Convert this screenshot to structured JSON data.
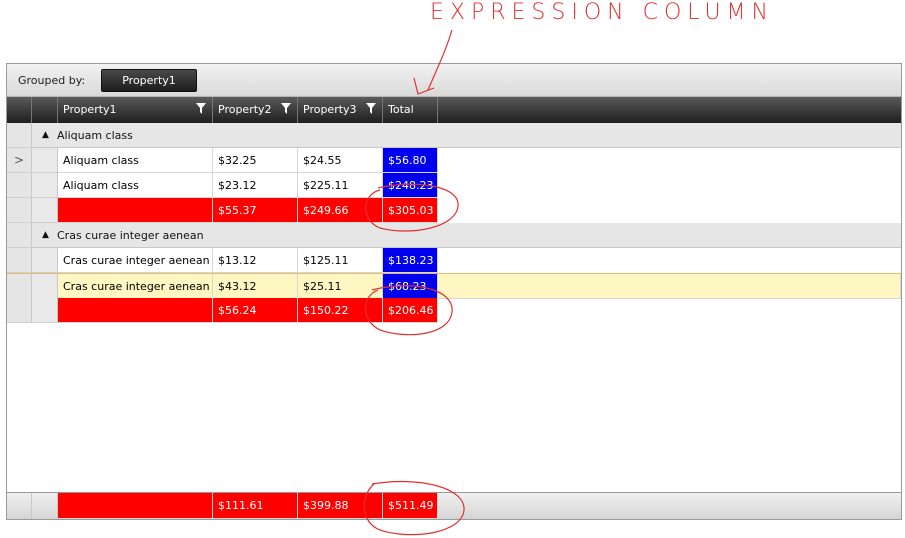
{
  "annotation": {
    "text": "EXPRESSION COLUMN"
  },
  "group_panel": {
    "label": "Grouped by:",
    "chip": "Property1"
  },
  "columns": [
    "Property1",
    "Property2",
    "Property3",
    "Total"
  ],
  "groups": [
    {
      "name": "Aliquam class",
      "rows": [
        {
          "p1": "Aliquam class",
          "p2": "$32.25",
          "p3": "$24.55",
          "total": "$56.80"
        },
        {
          "p1": "Aliquam class",
          "p2": "$23.12",
          "p3": "$225.11",
          "total": "$248.23"
        }
      ],
      "aggregate": {
        "p2": "$55.37",
        "p3": "$249.66",
        "total": "$305.03"
      }
    },
    {
      "name": "Cras curae integer aenean",
      "rows": [
        {
          "p1": "Cras curae integer aenean",
          "p2": "$13.12",
          "p3": "$125.11",
          "total": "$138.23"
        },
        {
          "p1": "Cras curae integer aenean",
          "p2": "$43.12",
          "p3": "$25.11",
          "total": "$68.23"
        }
      ],
      "aggregate": {
        "p2": "$56.24",
        "p3": "$150.22",
        "total": "$206.46"
      }
    }
  ],
  "footer": {
    "p2": "$111.61",
    "p3": "$399.88",
    "total": "$511.49"
  },
  "colors": {
    "total_bg": "#0000ee",
    "aggregate_bg": "#ff0000",
    "selected_row": "#fff7c2",
    "annotation": "#e03030"
  }
}
